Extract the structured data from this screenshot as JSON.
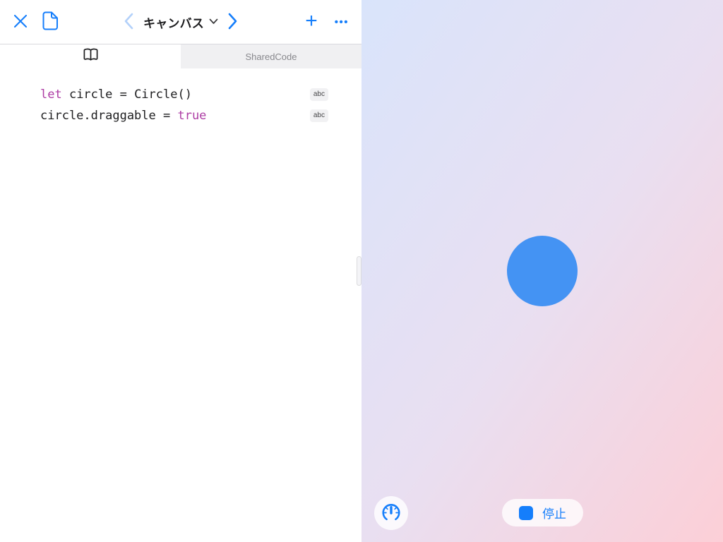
{
  "toolbar": {
    "title": "キャンバス",
    "plus_label": "+",
    "more_label": "•••"
  },
  "tabs": {
    "shared_code_label": "SharedCode"
  },
  "editor": {
    "lines": [
      {
        "keyword": "let",
        "code": " circle = Circle()",
        "badge": "abc"
      },
      {
        "code": "circle.draggable = ",
        "keyword": "true",
        "badge": "abc"
      }
    ]
  },
  "canvas": {
    "stop_label": "停止"
  },
  "icons": {
    "close": "close-icon",
    "new_document": "document-icon",
    "back": "chevron-left-icon",
    "title_disclosure": "chevron-down-icon",
    "forward": "chevron-right-icon",
    "add": "plus-icon",
    "more": "ellipsis-icon",
    "guide_tab": "book-icon",
    "run_speed": "gauge-icon",
    "stop": "stop-square-icon"
  },
  "colors": {
    "accent_blue": "#157EFB",
    "disabled_blue": "#b3d1fa",
    "keyword_magenta": "#AD3DA4",
    "circle_fill": "#4493f3",
    "canvas_gradient_start": "#d9e4fb",
    "canvas_gradient_end": "#fccfd7",
    "inactive_tab_bg": "#f0f0f2"
  }
}
